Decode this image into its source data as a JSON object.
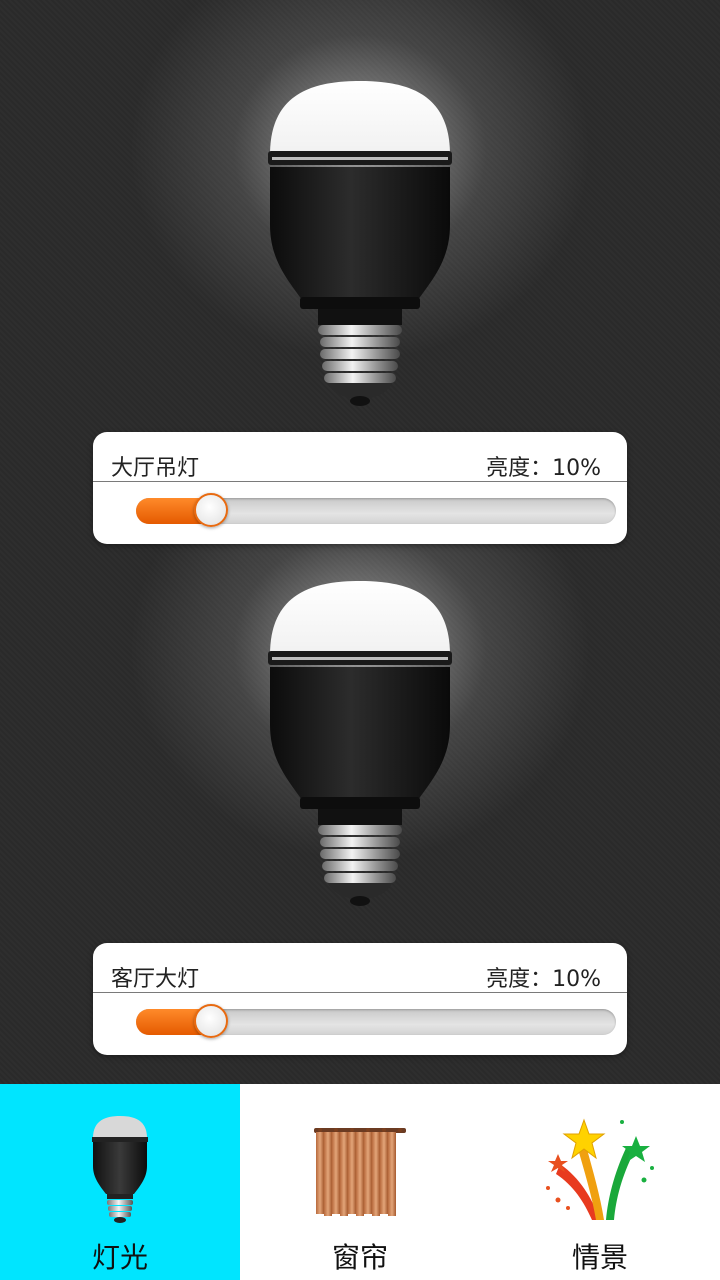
{
  "lights": [
    {
      "name": "大厅吊灯",
      "brightness_label": "亮度：10%",
      "brightness_value": 0.1
    },
    {
      "name": "客厅大灯",
      "brightness_label": "亮度：10%",
      "brightness_value": 0.1
    }
  ],
  "tabs": [
    {
      "label": "灯光",
      "icon": "bulb-icon",
      "active": true
    },
    {
      "label": "窗帘",
      "icon": "curtain-icon",
      "active": false
    },
    {
      "label": "情景",
      "icon": "stars-icon",
      "active": false
    }
  ],
  "colors": {
    "accent_orange": "#e55a00",
    "active_tab": "#00e5ff"
  }
}
